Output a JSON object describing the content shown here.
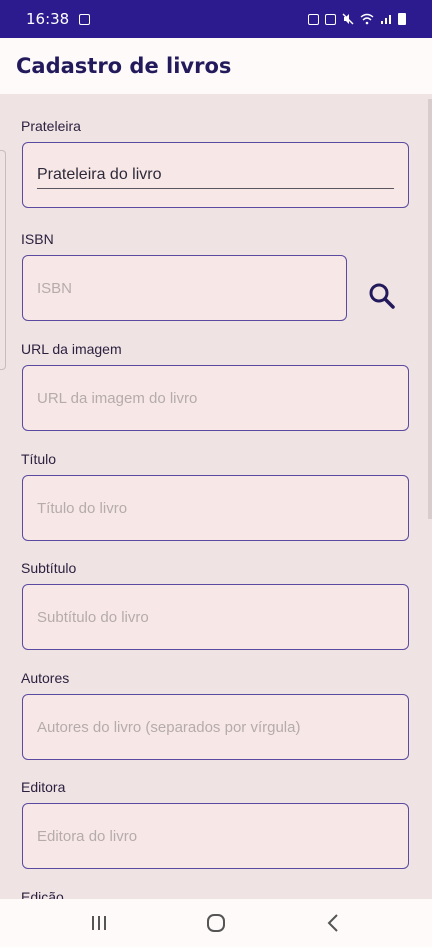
{
  "status": {
    "time": "16:38"
  },
  "app_bar": {
    "title": "Cadastro de livros"
  },
  "form": {
    "shelf": {
      "label": "Prateleira",
      "value": "Prateleira do livro"
    },
    "isbn": {
      "label": "ISBN",
      "placeholder": "ISBN"
    },
    "image_url": {
      "label": "URL da imagem",
      "placeholder": "URL da imagem do livro"
    },
    "title": {
      "label": "Título",
      "placeholder": "Título do livro"
    },
    "subtitle": {
      "label": "Subtítulo",
      "placeholder": "Subtítulo do livro"
    },
    "authors": {
      "label": "Autores",
      "placeholder": "Autores do livro (separados por vírgula)"
    },
    "publisher": {
      "label": "Editora",
      "placeholder": "Editora do livro"
    },
    "edition": {
      "label": "Edição"
    }
  },
  "colors": {
    "status_bar": "#2b1b8f",
    "accent": "#231a5c",
    "field_border": "#5a4aa0",
    "background": "#efe3e3"
  },
  "icons": {
    "search": "search-icon",
    "recents": "recent-apps-icon",
    "home": "home-icon",
    "back": "back-icon"
  }
}
